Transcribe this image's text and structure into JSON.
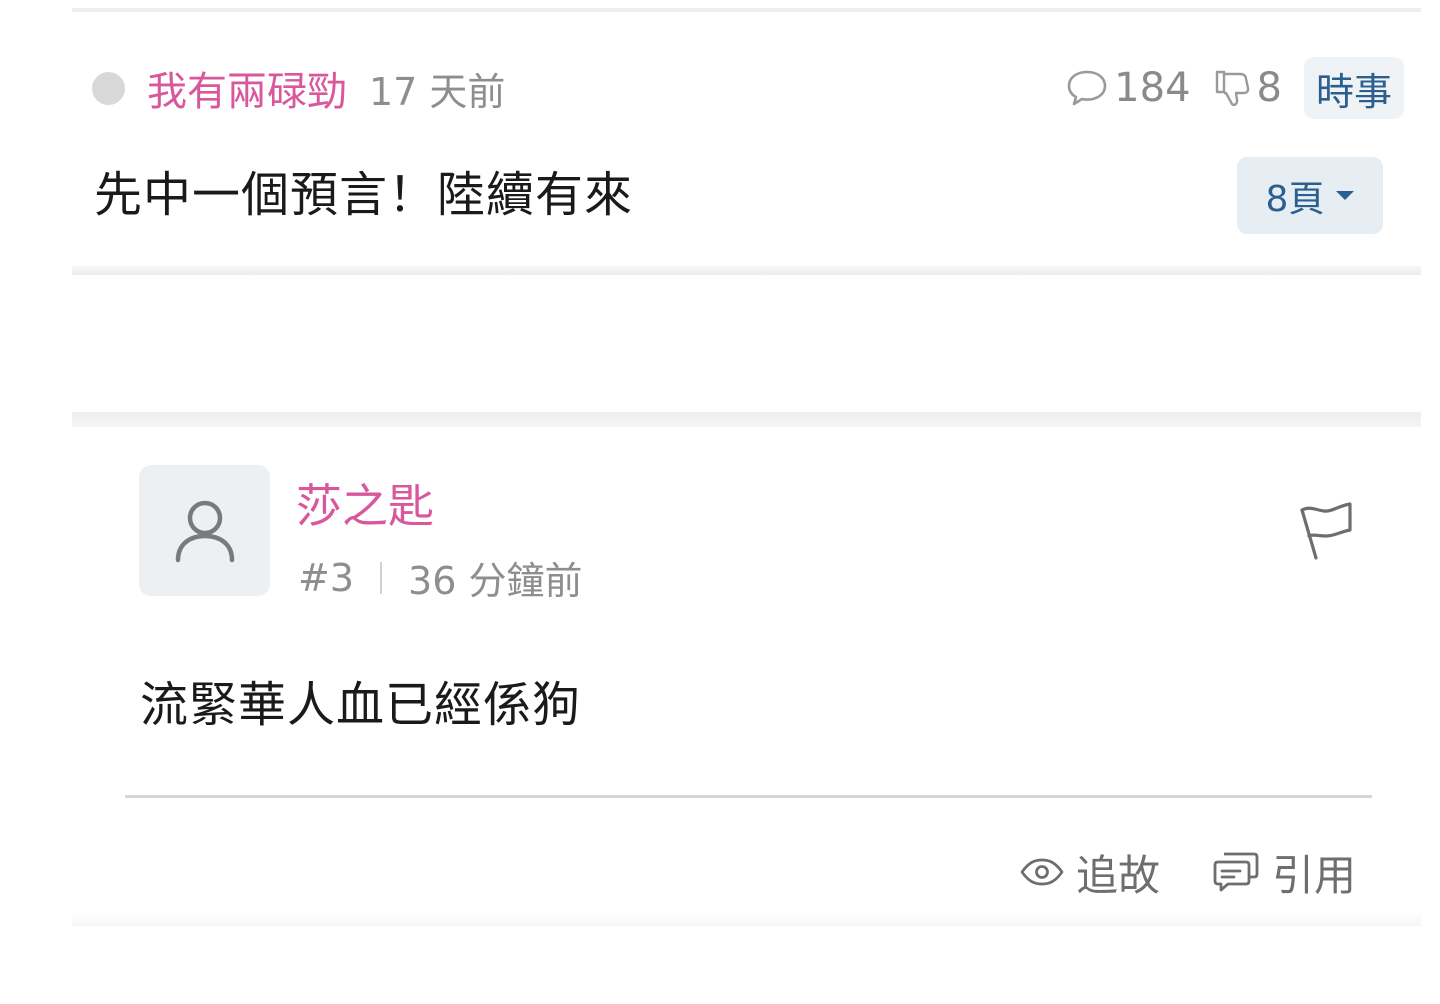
{
  "thread": {
    "author": "我有兩碌勁",
    "time": "17 天前",
    "comment_count": "184",
    "dislike_count": "8",
    "category": "時事",
    "title": "先中一個預言！陸續有來",
    "page_label": "8頁"
  },
  "reply": {
    "author": "莎之匙",
    "number": "#3",
    "time": "36 分鐘前",
    "body": "流緊華人血已經係狗",
    "actions": {
      "follow": "追故",
      "quote": "引用"
    }
  },
  "icons": {
    "status": "status-dot",
    "comment": "comment-icon",
    "dislike": "thumbs-down-icon",
    "avatar": "user-icon",
    "report": "flag-icon",
    "follow": "eye-icon",
    "quote": "quote-icon"
  },
  "colors": {
    "author_pink": "#d9579b",
    "link_blue": "#2c5f8f",
    "tag_bg": "#e6edf3"
  }
}
